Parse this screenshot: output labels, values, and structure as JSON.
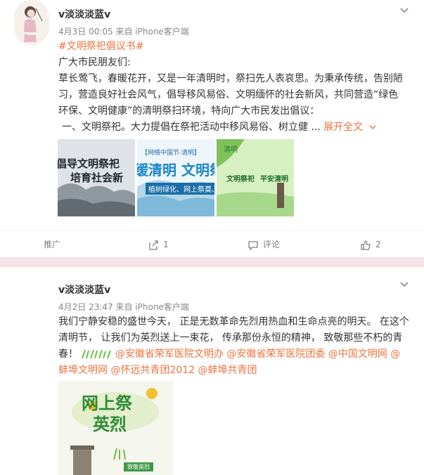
{
  "posts": [
    {
      "username": "v淡淡淡蓝v",
      "meta": "4月3日 00:05 来自 iPhone客户端",
      "topic": "#文明祭祀倡议书#",
      "lines": [
        "广大市民朋友们:",
        "草长莺飞，春暖花开，又是一年清明时，祭扫先人表哀思。为秉承传统，告别陋",
        "习，营造良好社会风气，倡导移风易俗、文明缅怀的社会新风，共同营造“绿色",
        "环保、文明健康”的清明祭扫环境，特向广大市民发出倡议：",
        "一、文明祭祀。大力提倡在祭祀活动中移风易俗、树立健 ..."
      ],
      "expand": "展开全文",
      "images": [
        {
          "lines": [
            "倡导文明祭祀",
            "培育社会新"
          ]
        },
        {
          "top": "【网络中国节·清明】",
          "big": "缓清明 文明祭",
          "small": "植树绿化、网上祭奠、"
        },
        {
          "tag": "清明",
          "a": "文明祭祀",
          "b": "平安清明"
        }
      ],
      "actions": {
        "forward_label": "推广",
        "share_count": "1",
        "comment_label": "评论",
        "like_count": "2"
      }
    },
    {
      "username": "v淡淡淡蓝v",
      "meta": "4月2日 23:47 来自 iPhone客户端",
      "line1": "我们宁静安稳的盛世今天， 正是无数革命先烈用热血和生命点亮的明天。 在这个",
      "line2": "清明节， 让我们为英烈送上一束花， 传承那份永恒的精神， 致敬那些不朽的青",
      "line3_pre": "春！",
      "mentions_inline": "@安徽省荣军医院文明办 @安徽省荣军医院团委 @中国文明网 @",
      "mentions_line4": "蚌埠文明网 @怀远共青团2012 @蚌埠共青团",
      "poster": {
        "title1": "网上祭",
        "title2": "英烈",
        "button": "致敬英烈"
      }
    }
  ]
}
